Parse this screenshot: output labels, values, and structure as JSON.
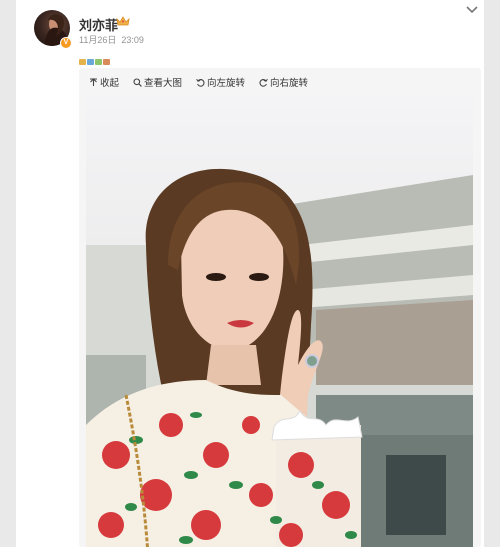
{
  "post": {
    "username": "刘亦菲",
    "date": "11月26日",
    "time": "23:09",
    "verified_badge": "V"
  },
  "toolbar": {
    "collapse_label": "收起",
    "view_large_label": "查看大图",
    "rotate_left_label": "向左旋转",
    "rotate_right_label": "向右旋转"
  },
  "icons": {
    "collapse": "arrow-up-icon",
    "view_large": "magnifier-icon",
    "rotate_left": "rotate-left-icon",
    "rotate_right": "rotate-right-icon",
    "expand": "chevron-down-icon",
    "member": "crown-icon"
  },
  "colors": {
    "accent": "#f59a23",
    "username": "#333333",
    "meta": "#939393",
    "toolbar_bg": "#f5f5f5"
  }
}
